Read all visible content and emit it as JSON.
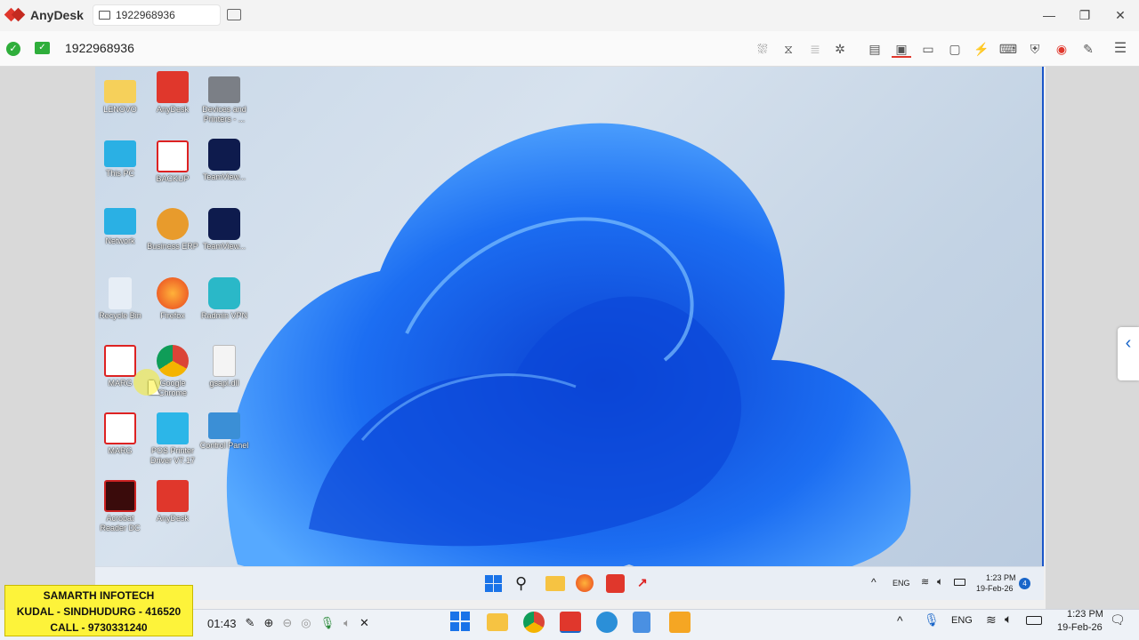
{
  "window": {
    "app_name": "AnyDesk",
    "tab_label": "1922968936",
    "controls": {
      "minimize": "—",
      "maximize": "❐",
      "close": "✕"
    }
  },
  "session": {
    "remote_id": "1922968936"
  },
  "toolbar_icons": [
    "incognito-icon",
    "hourglass-icon",
    "database-icon",
    "star-icon",
    "file-transfer-icon",
    "display-icon",
    "chat-icon",
    "whiteboard-icon",
    "actions-icon",
    "keyboard-icon",
    "permissions-icon",
    "record-icon",
    "draw-icon",
    "menu-icon"
  ],
  "remote_desktop": {
    "icons": [
      {
        "label": "LENOVO"
      },
      {
        "label": "AnyDesk"
      },
      {
        "label": "Devices and Printers - ..."
      },
      {
        "label": "This PC"
      },
      {
        "label": "BACKUP"
      },
      {
        "label": "TeamView..."
      },
      {
        "label": "Network"
      },
      {
        "label": "Business ERP"
      },
      {
        "label": "TeamView..."
      },
      {
        "label": "Recycle Bin"
      },
      {
        "label": "Firefox"
      },
      {
        "label": "Radmin VPN"
      },
      {
        "label": "MARG"
      },
      {
        "label": "Google Chrome"
      },
      {
        "label": "gsapi.dll"
      },
      {
        "label": "MARG"
      },
      {
        "label": "POS Printer Driver V7.17"
      },
      {
        "label": "Control Panel"
      },
      {
        "label": "Acrobat Reader DC"
      },
      {
        "label": "AnyDesk"
      }
    ],
    "taskbar": {
      "lang": "ENG",
      "time": "1:23 PM",
      "date": "19-Feb-26",
      "notif_count": "4"
    }
  },
  "banner": {
    "line1": "SAMARTH INFOTECH",
    "line2": "KUDAL - SINDHUDURG - 416520",
    "line3": "CALL - 9730331240"
  },
  "recorder": {
    "time": "01:43"
  },
  "local_taskbar": {
    "lang": "ENG",
    "time": "1:23 PM",
    "date": "19-Feb-26"
  },
  "colors": {
    "accent": "#e0372c",
    "selection": "#1a56c9",
    "banner": "#fdf33a"
  }
}
